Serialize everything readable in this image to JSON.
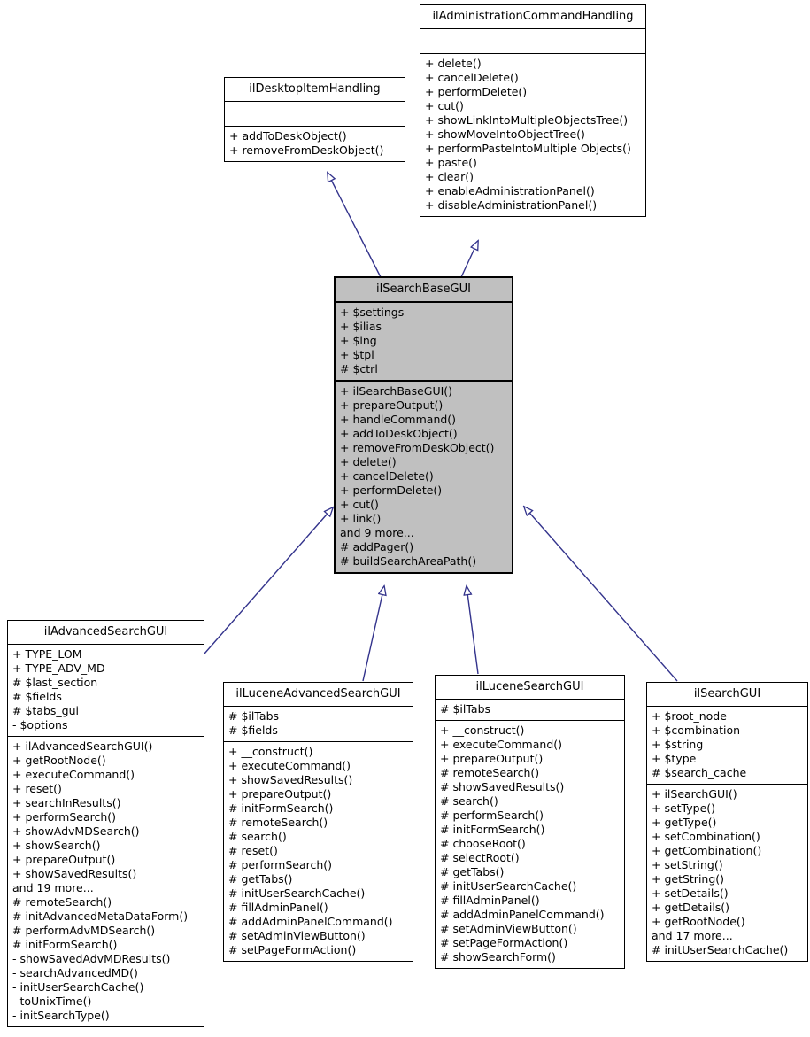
{
  "diagram": {
    "kind": "uml-class-diagram",
    "background": "#ffffff",
    "edge_color": "#33338c",
    "highlight_fill": "#c0c0c0",
    "border_color": "#000000",
    "relationship": "generalization"
  },
  "classes": {
    "ilAdministrationCommandHandling": {
      "name": "ilAdministrationCommandHandling",
      "attributes": [],
      "operations": [
        "+ delete()",
        "+ cancelDelete()",
        "+ performDelete()",
        "+ cut()",
        "+ showLinkIntoMultipleObjectsTree()",
        "+ showMoveIntoObjectTree()",
        "+ performPasteIntoMultiple Objects()",
        "+ paste()",
        "+ clear()",
        "+ enableAdministrationPanel()",
        "+ disableAdministrationPanel()"
      ]
    },
    "ilDesktopItemHandling": {
      "name": "ilDesktopItemHandling",
      "attributes": [],
      "operations": [
        "+ addToDeskObject()",
        "+ removeFromDeskObject()"
      ]
    },
    "ilSearchBaseGUI": {
      "name": "ilSearchBaseGUI",
      "attributes": [
        "+ $settings",
        "+ $ilias",
        "+ $lng",
        "+ $tpl",
        "# $ctrl"
      ],
      "operations": [
        "+ ilSearchBaseGUI()",
        "+ prepareOutput()",
        "+ handleCommand()",
        "+ addToDeskObject()",
        "+ removeFromDeskObject()",
        "+ delete()",
        "+ cancelDelete()",
        "+ performDelete()",
        "+ cut()",
        "+ link()",
        "and 9 more...",
        "# addPager()",
        "# buildSearchAreaPath()"
      ]
    },
    "ilAdvancedSearchGUI": {
      "name": "ilAdvancedSearchGUI",
      "attributes": [
        "+ TYPE_LOM",
        "+ TYPE_ADV_MD",
        "# $last_section",
        "# $fields",
        "# $tabs_gui",
        "- $options"
      ],
      "operations": [
        "+ ilAdvancedSearchGUI()",
        "+ getRootNode()",
        "+ executeCommand()",
        "+ reset()",
        "+ searchInResults()",
        "+ performSearch()",
        "+ showAdvMDSearch()",
        "+ showSearch()",
        "+ prepareOutput()",
        "+ showSavedResults()",
        "and 19 more...",
        "# remoteSearch()",
        "# initAdvancedMetaDataForm()",
        "# performAdvMDSearch()",
        "# initFormSearch()",
        "- showSavedAdvMDResults()",
        "- searchAdvancedMD()",
        "- initUserSearchCache()",
        "- toUnixTime()",
        "- initSearchType()"
      ]
    },
    "ilLuceneAdvancedSearchGUI": {
      "name": "ilLuceneAdvancedSearchGUI",
      "attributes": [
        "# $ilTabs",
        "# $fields"
      ],
      "operations": [
        "+ __construct()",
        "+ executeCommand()",
        "+ showSavedResults()",
        "+ prepareOutput()",
        "# initFormSearch()",
        "# remoteSearch()",
        "# search()",
        "# reset()",
        "# performSearch()",
        "# getTabs()",
        "# initUserSearchCache()",
        "# fillAdminPanel()",
        "# addAdminPanelCommand()",
        "# setAdminViewButton()",
        "# setPageFormAction()"
      ]
    },
    "ilLuceneSearchGUI": {
      "name": "ilLuceneSearchGUI",
      "attributes": [
        "# $ilTabs"
      ],
      "operations": [
        "+ __construct()",
        "+ executeCommand()",
        "+ prepareOutput()",
        "# remoteSearch()",
        "# showSavedResults()",
        "# search()",
        "# performSearch()",
        "# initFormSearch()",
        "# chooseRoot()",
        "# selectRoot()",
        "# getTabs()",
        "# initUserSearchCache()",
        "# fillAdminPanel()",
        "# addAdminPanelCommand()",
        "# setAdminViewButton()",
        "# setPageFormAction()",
        "# showSearchForm()"
      ]
    },
    "ilSearchGUI": {
      "name": "ilSearchGUI",
      "attributes": [
        "+ $root_node",
        "+ $combination",
        "+ $string",
        "+ $type",
        "# $search_cache"
      ],
      "operations": [
        "+ ilSearchGUI()",
        "+ setType()",
        "+ getType()",
        "+ setCombination()",
        "+ getCombination()",
        "+ setString()",
        "+ getString()",
        "+ setDetails()",
        "+ getDetails()",
        "+ getRootNode()",
        "and 17 more...",
        "# initUserSearchCache()"
      ]
    }
  }
}
